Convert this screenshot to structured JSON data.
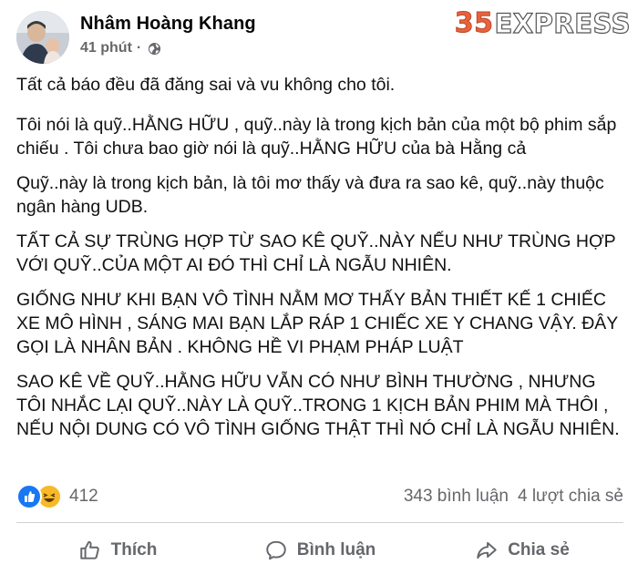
{
  "post": {
    "author": "Nhâm Hoàng Khang",
    "time": "41 phút",
    "separator": "·",
    "privacy_icon": "globe-icon",
    "paragraphs": [
      "Tất cả báo đều đã đăng sai và vu không cho tôi.",
      "Tôi nói là quỹ..HẰNG HỮU , quỹ..này là trong kịch bản của một bộ phim sắp chiếu . Tôi chưa bao giờ nói là quỹ..HẰNG HỮU của bà Hằng cả",
      "Quỹ..này là trong kịch bản, là tôi mơ thấy và đưa ra sao kê, quỹ..này thuộc ngân hàng UDB.",
      "TẤT CẢ SỰ TRÙNG HỢP TỪ SAO KÊ QUỸ..NÀY NẾU NHƯ TRÙNG HỢP VỚI QUỸ..CỦA MỘT AI ĐÓ THÌ CHỈ LÀ NGẪU NHIÊN.",
      "GIỐNG NHƯ KHI BẠN VÔ TÌNH NẰM MƠ THẤY BẢN THIẾT KẾ 1 CHIẾC XE MÔ HÌNH , SÁNG MAI BẠN LẮP RÁP 1 CHIẾC XE Y CHANG VẬY. ĐÂY GỌI LÀ NHÂN BẢN . KHÔNG HỀ VI PHẠM PHÁP LUẬT",
      "SAO KÊ VỀ QUỸ..HẰNG HỮU VẪN CÓ NHƯ BÌNH THƯỜNG , NHƯNG TÔI NHẮC LẠI QUỸ..NÀY LÀ QUỸ..TRONG 1 KỊCH BẢN PHIM MÀ THÔI , NẾU NỘI DUNG CÓ VÔ TÌNH GIỐNG THẬT THÌ NÓ CHỈ LÀ NGẪU NHIÊN."
    ]
  },
  "watermark": {
    "number": "35",
    "text": "EXPRESS"
  },
  "stats": {
    "reaction_count": "412",
    "comments": "343 bình luận",
    "shares": "4 lượt chia sẻ"
  },
  "actions": {
    "like": "Thích",
    "comment": "Bình luận",
    "share": "Chia sẻ"
  },
  "colors": {
    "like_blue": "#1877f2",
    "haha_yellow": "#f7b928",
    "secondary_text": "#65676b",
    "watermark_orange": "#e9623d"
  }
}
